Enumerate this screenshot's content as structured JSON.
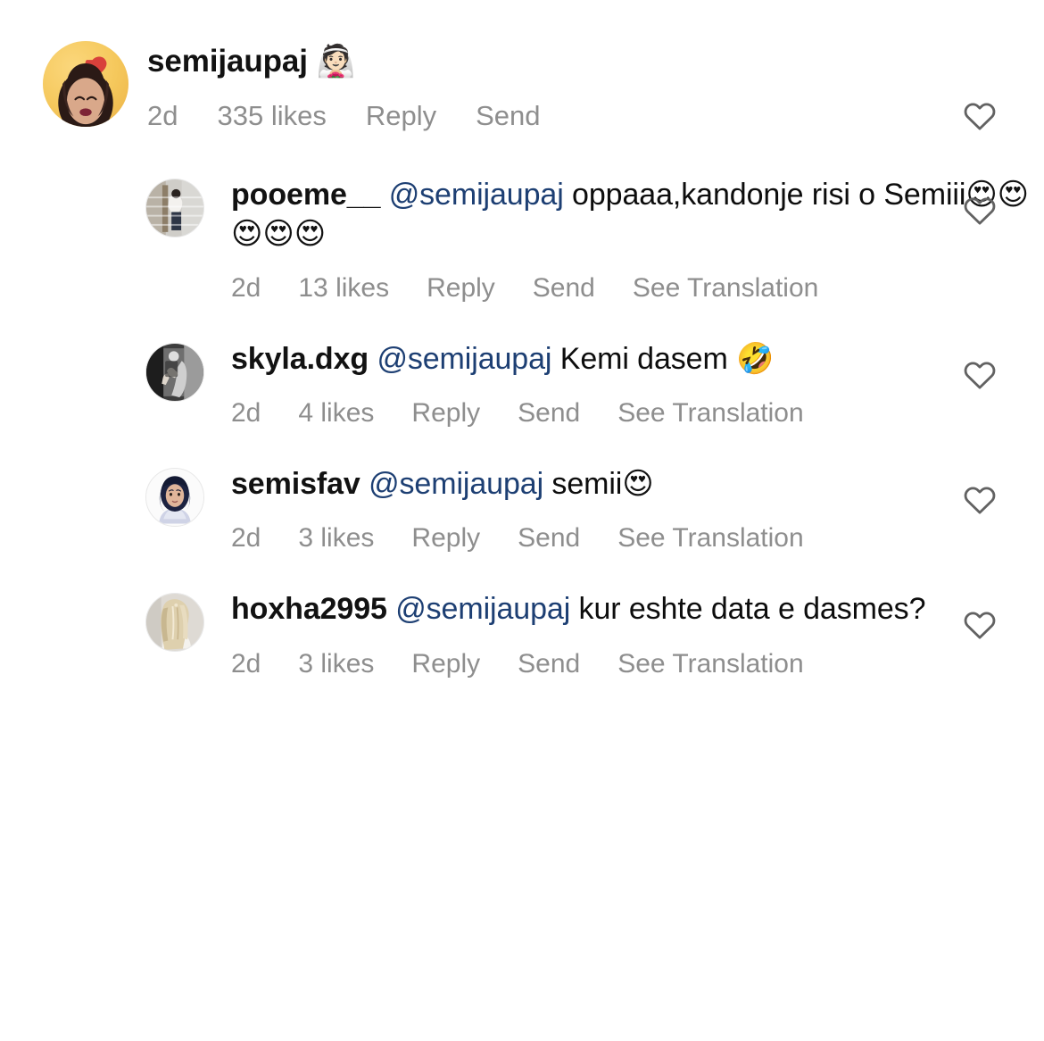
{
  "screen": {
    "app": "Instagram",
    "view": "post-comments",
    "background_color": "#ffffff",
    "mention_color": "#1d3f73",
    "meta_color": "#8e8e8e",
    "text_color": "#121212"
  },
  "labels": {
    "reply": "Reply",
    "send": "Send",
    "see_translation": "See Translation",
    "like_icon": "heart-outline-icon"
  },
  "comments": [
    {
      "type": "top-level",
      "username": "semijaupaj",
      "avatar": "emoji-avatar-orange-heart",
      "text_emoji": "👰🏻",
      "mention": "",
      "text": "",
      "time": "2d",
      "likes": "335 likes",
      "reply": "Reply",
      "send": "Send",
      "see_translation": ""
    },
    {
      "type": "reply",
      "username": "pooeme__",
      "avatar": "photo-person-white-top",
      "mention": "@semijaupaj",
      "text": "oppaaa,kandonje risi o Semiii",
      "text_emoji": "😍😍😍😍😍",
      "time": "2d",
      "likes": "13 likes",
      "reply": "Reply",
      "send": "Send",
      "see_translation": "See Translation"
    },
    {
      "type": "reply",
      "username": "skyla.dxg",
      "avatar": "photo-bw-mirror-selfie",
      "mention": "@semijaupaj",
      "text": "Kemi dasem",
      "text_emoji": "🤣",
      "time": "2d",
      "likes": "4 likes",
      "reply": "Reply",
      "send": "Send",
      "see_translation": "See Translation"
    },
    {
      "type": "reply",
      "username": "semisfav",
      "avatar": "illustrated-avatar-dark-hair",
      "mention": "@semijaupaj",
      "text": "semii",
      "text_emoji": "😍",
      "time": "2d",
      "likes": "3 likes",
      "reply": "Reply",
      "send": "Send",
      "see_translation": "See Translation"
    },
    {
      "type": "reply",
      "username": "hoxha2995",
      "avatar": "photo-blonde-hair-back",
      "mention": "@semijaupaj",
      "text": "kur eshte data e dasmes?",
      "text_emoji": "",
      "time": "2d",
      "likes": "3 likes",
      "reply": "Reply",
      "send": "Send",
      "see_translation": "See Translation"
    }
  ]
}
